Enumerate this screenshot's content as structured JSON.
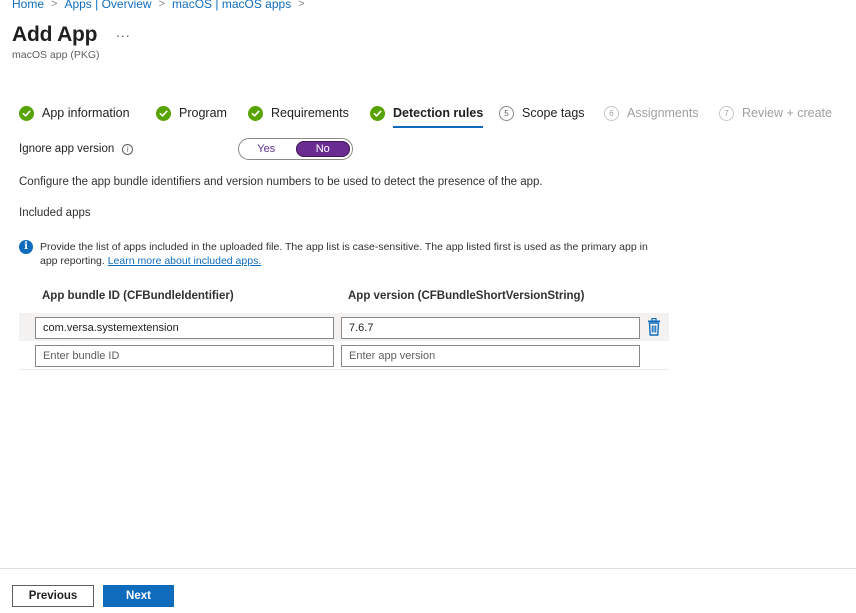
{
  "breadcrumb": [
    "Home",
    "Apps | Overview",
    "macOS | macOS apps"
  ],
  "breadcrumb_sep": ">",
  "page": {
    "title": "Add App",
    "more": "...",
    "subtitle": "macOS app (PKG)"
  },
  "wizard": {
    "steps": [
      {
        "label": "App information",
        "state": "done"
      },
      {
        "label": "Program",
        "state": "done"
      },
      {
        "label": "Requirements",
        "state": "done"
      },
      {
        "label": "Detection rules",
        "state": "active"
      },
      {
        "label": "Scope tags",
        "state": "pending",
        "number": "5"
      },
      {
        "label": "Assignments",
        "state": "disabled",
        "number": "6"
      },
      {
        "label": "Review + create",
        "state": "disabled",
        "number": "7"
      }
    ]
  },
  "ignore_version": {
    "label": "Ignore app version",
    "info_icon": "info-icon",
    "yes": "Yes",
    "no": "No",
    "selected": "No"
  },
  "description": "Configure the app bundle identifiers and version numbers to be used to detect the presence of the app.",
  "included_apps_heading": "Included apps",
  "info": {
    "text": "Provide the list of apps included in the uploaded file. The app list is case-sensitive. The app listed first is used as the primary app in app reporting.",
    "link": "Learn more about included apps."
  },
  "table": {
    "columns": [
      "App bundle ID (CFBundleIdentifier)",
      "App version (CFBundleShortVersionString)"
    ],
    "rows": [
      {
        "bundle_id": "com.versa.systemextension",
        "version": "7.6.7"
      }
    ],
    "new_row": {
      "bundle_placeholder": "Enter bundle ID",
      "version_placeholder": "Enter app version"
    },
    "delete_icon": "trash-icon"
  },
  "footer": {
    "previous": "Previous",
    "next": "Next"
  },
  "colors": {
    "accent": "#0f6cbd",
    "success": "#57a300",
    "toggle_selected": "#6a2c91"
  }
}
